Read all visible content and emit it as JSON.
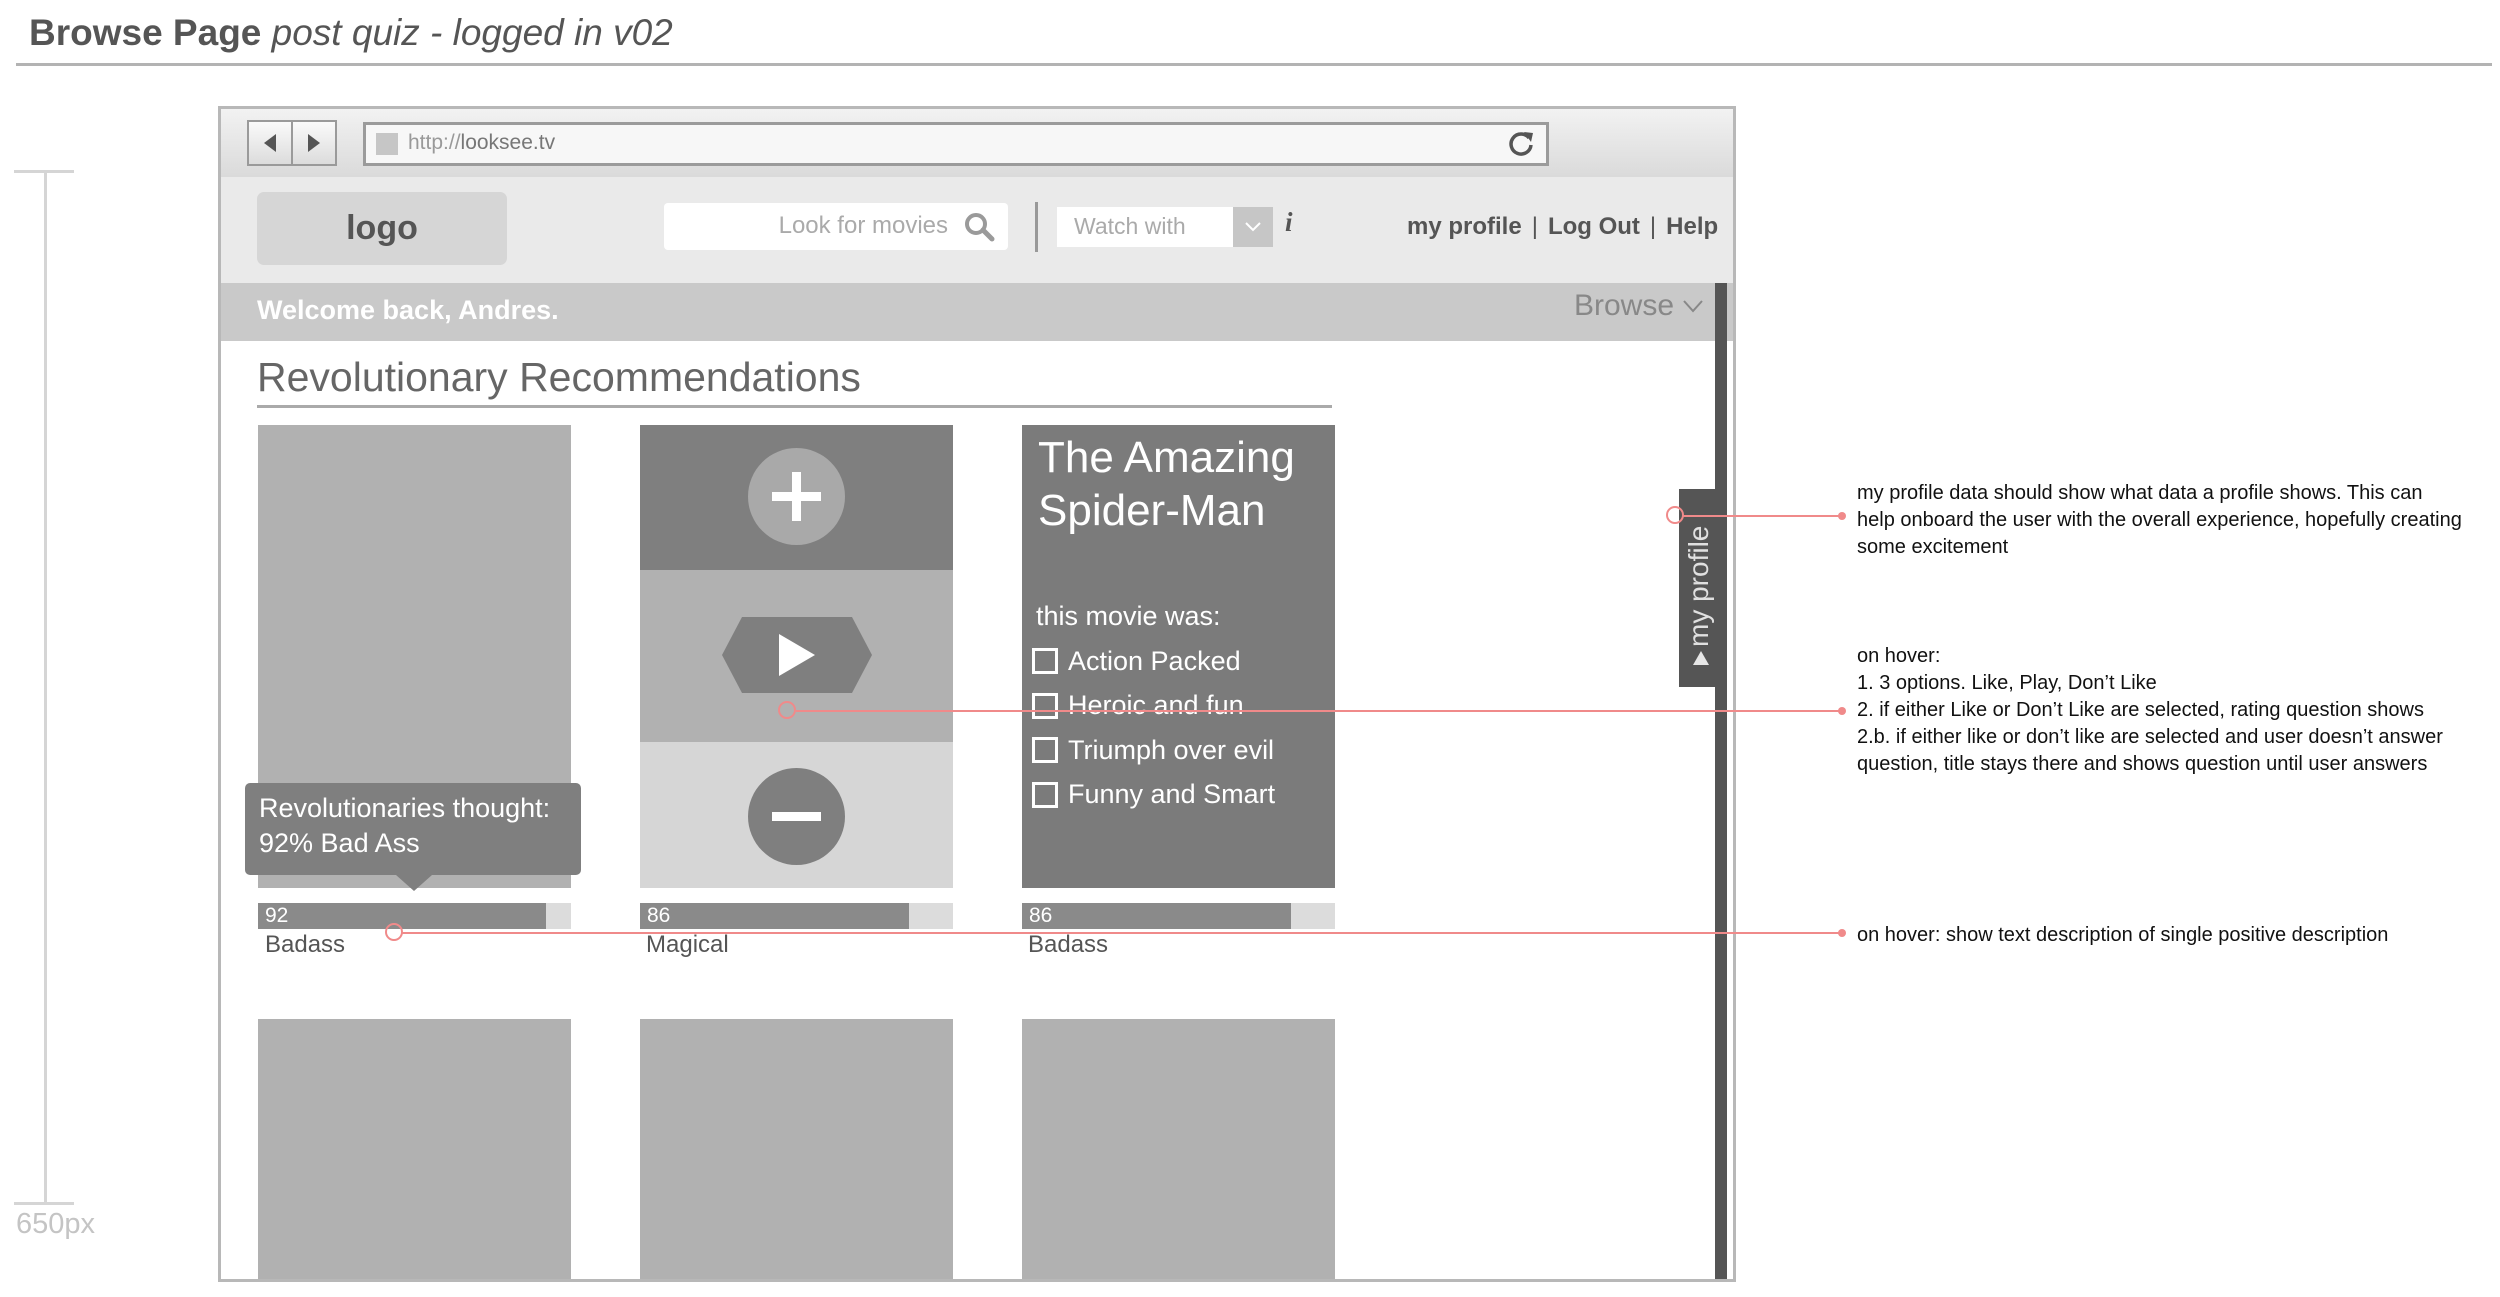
{
  "doc": {
    "title_bold": "Browse Page",
    "title_italic": "post quiz - logged in v02",
    "ruler_label": "650px"
  },
  "browser": {
    "url_scheme": "http://",
    "url_host": "looksee.tv"
  },
  "header": {
    "logo": "logo",
    "search_placeholder": "Look for movies",
    "watch_with": "Watch with",
    "info": "i",
    "links": [
      "my profile",
      "Log Out",
      "Help"
    ],
    "link_separator": "|"
  },
  "welcome": {
    "text": "Welcome back, Andres.",
    "browse_label": "Browse"
  },
  "profile_tab": {
    "label": "my profile"
  },
  "section": {
    "title": "Revolutionary Recommendations"
  },
  "cards": [
    {
      "score": "92",
      "score_value": 92,
      "label": "Badass"
    },
    {
      "score": "86",
      "score_value": 86,
      "label": "Magical"
    },
    {
      "score": "86",
      "score_value": 86,
      "label": "Badass"
    }
  ],
  "tooltip": {
    "line1": "Revolutionaries thought:",
    "line2": "92% Bad Ass"
  },
  "rating_card": {
    "title": "The Amazing Spider-Man",
    "question": "this movie was:",
    "options": [
      "Action Packed",
      "Heroic and fun",
      "Triumph over evil",
      "Funny and Smart"
    ]
  },
  "annotations": {
    "profile": [
      "my profile data should show what data a profile shows. This can",
      "help onboard the user with the overall experience, hopefully creating",
      "some excitement"
    ],
    "hover_actions": [
      "on hover:",
      "1. 3 options. Like, Play, Don’t Like",
      "2. if either Like or Don’t Like are selected, rating question shows",
      "2.b. if either like or don’t like are selected and user doesn’t answer",
      "question, title stays there and shows question until user answers"
    ],
    "hover_score": "on hover: show text description of single positive description"
  },
  "colors": {
    "annotation_line": "#f08a8a",
    "dark_card": "#7b7b7b",
    "poster": "#b1b1b1"
  }
}
